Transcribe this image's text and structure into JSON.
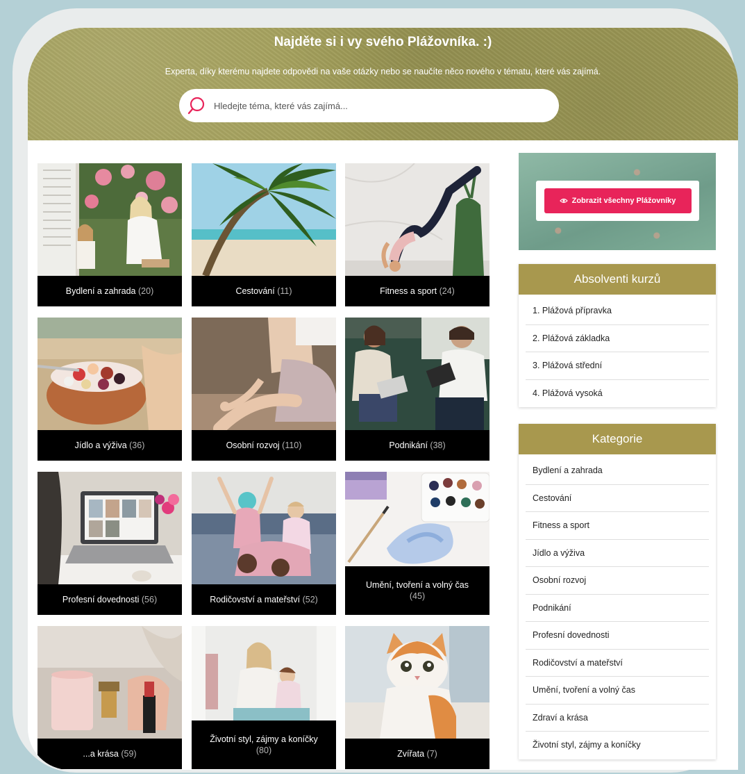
{
  "hero": {
    "title": "Najděte si i vy svého Plážovníka. :)",
    "subtitle": "Experta, díky kterému najdete odpovědi na vaše otázky nebo se naučíte něco nového v tématu, které vás zajímá.",
    "search_placeholder": "Hledejte téma, které vás zajímá..."
  },
  "tiles": [
    {
      "name": "Bydlení a zahrada",
      "count": "(20)"
    },
    {
      "name": "Cestování",
      "count": "(11)"
    },
    {
      "name": "Fitness a sport",
      "count": "(24)"
    },
    {
      "name": "Jídlo a výživa",
      "count": "(36)"
    },
    {
      "name": "Osobní rozvoj",
      "count": "(110)"
    },
    {
      "name": "Podnikání",
      "count": "(38)"
    },
    {
      "name": "Profesní dovednosti",
      "count": "(56)"
    },
    {
      "name": "Rodičovství a mateřství",
      "count": "(52)"
    },
    {
      "name": "Umění, tvoření a volný čas",
      "count": "(45)"
    },
    {
      "name": "...a krása",
      "count": "(59)"
    },
    {
      "name": "Životní styl, zájmy a koníčky",
      "count": "(80)"
    },
    {
      "name": "Zvířata",
      "count": "(7)"
    }
  ],
  "promo": {
    "button_label": "Zobrazit všechny Plážovníky"
  },
  "absolventi": {
    "heading": "Absolventi kurzů",
    "items": [
      "1. Plážová přípravka",
      "2. Plážová základka",
      "3. Plážová střední",
      "4. Plážová vysoká"
    ]
  },
  "kategorie": {
    "heading": "Kategorie",
    "items": [
      "Bydlení a zahrada",
      "Cestování",
      "Fitness a sport",
      "Jídlo a výživa",
      "Osobní rozvoj",
      "Podnikání",
      "Profesní dovednosti",
      "Rodičovství a mateřství",
      "Umění, tvoření a volný čas",
      "Zdraví a krása",
      "Životní styl, zájmy a koníčky"
    ]
  },
  "colors": {
    "accent": "#e8245a",
    "gold": "#a8984e",
    "page_bg": "#b4d0d6"
  }
}
